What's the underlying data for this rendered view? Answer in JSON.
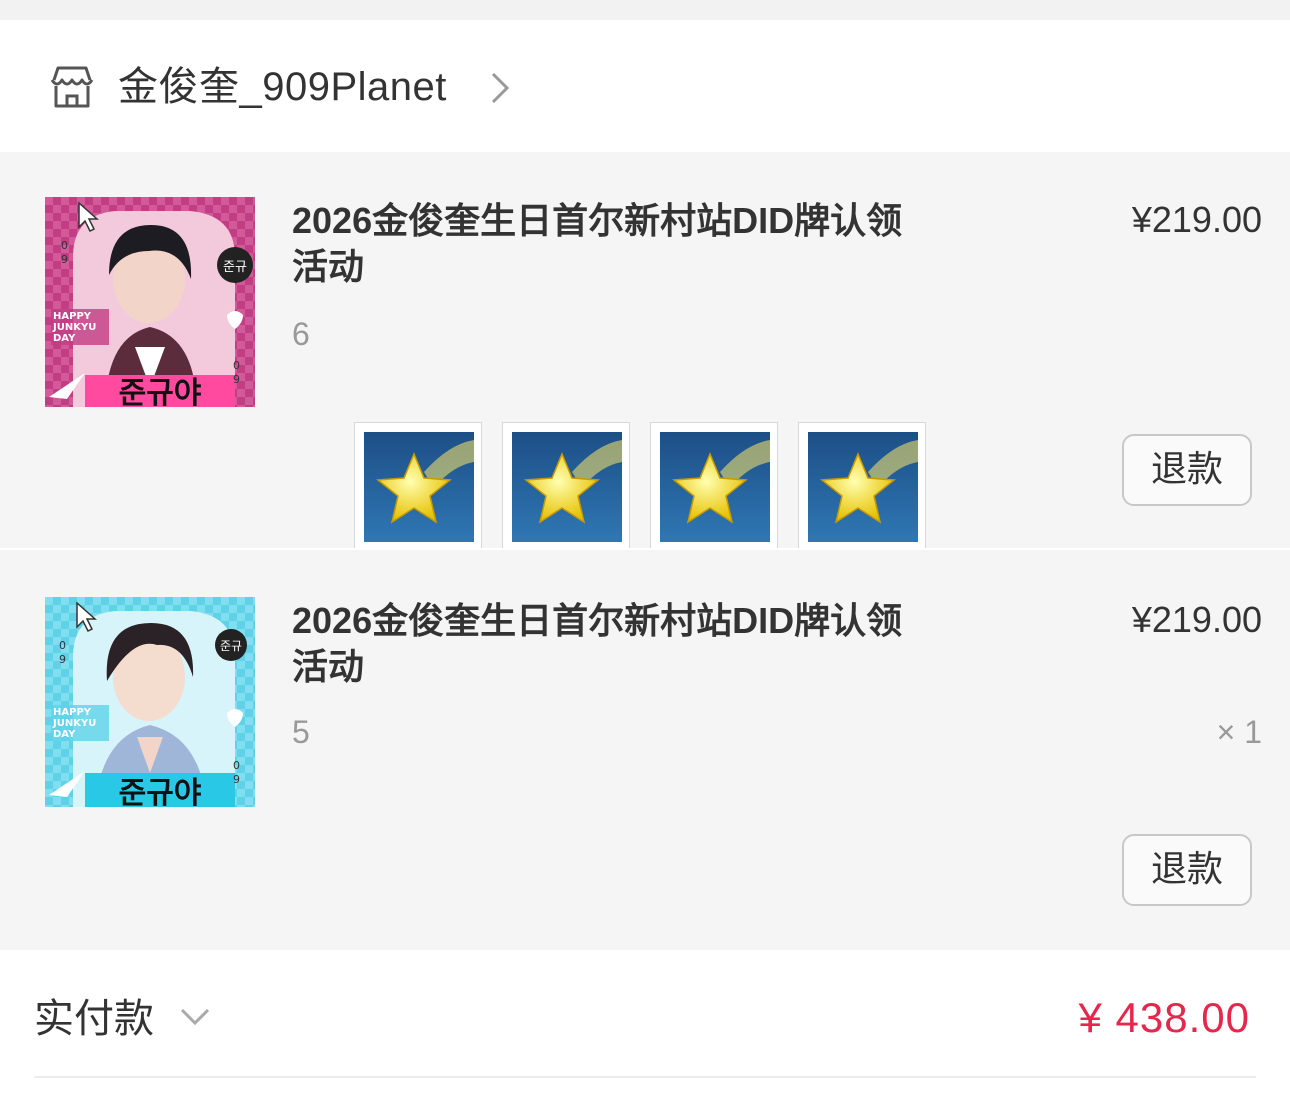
{
  "shop": {
    "name": "金俊奎_909Planet",
    "icon": "shop-icon"
  },
  "items": [
    {
      "title": "2026金俊奎生日首尔新村站DID牌认领活动",
      "variant": "6",
      "price": "¥219.00",
      "refund_label": "退款",
      "thumbnail_theme_color": "#c23d84",
      "thumbnail_text": [
        "HAPPY",
        "JUNKYU",
        "DAY"
      ]
    },
    {
      "title": "2026金俊奎生日首尔新村站DID牌认领活动",
      "variant": "5",
      "price": "¥219.00",
      "quantity": "× 1",
      "refund_label": "退款",
      "thumbnail_theme_color": "#5fd2e8",
      "thumbnail_text": [
        "HAPPY",
        "JUNKYU",
        "DAY"
      ]
    }
  ],
  "stickers": [
    "shooting-star-icon",
    "shooting-star-icon",
    "shooting-star-icon",
    "shooting-star-icon"
  ],
  "footer": {
    "label": "实付款",
    "total": "¥ 438.00",
    "total_color": "#e6264b"
  }
}
